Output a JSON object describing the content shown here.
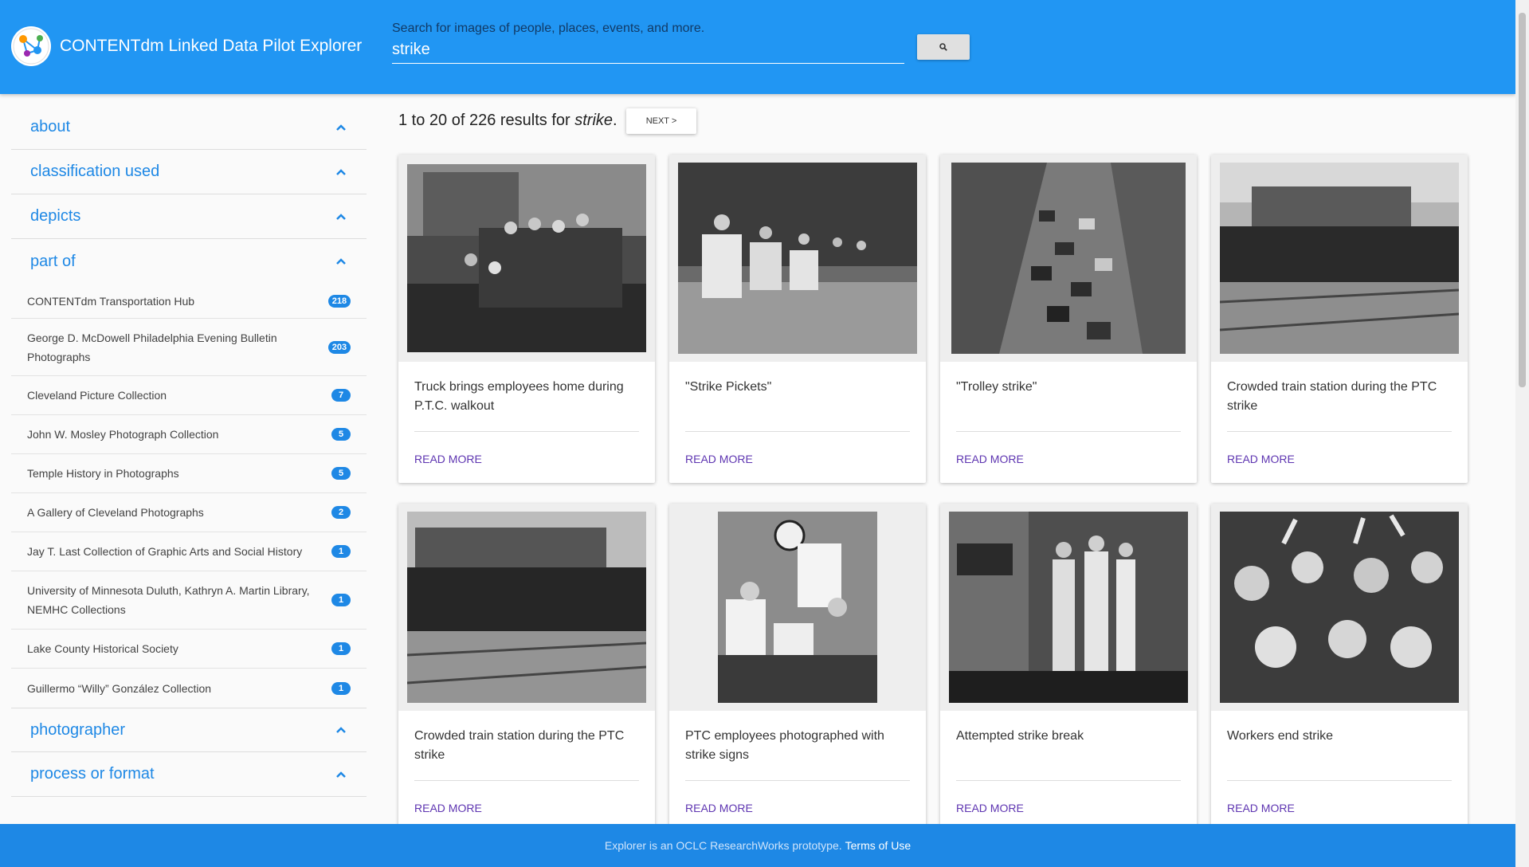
{
  "header": {
    "app_title": "CONTENTdm Linked Data Pilot Explorer",
    "search_hint": "Search for images of people, places, events, and more.",
    "search_value": "strike",
    "search_icon": "search-icon"
  },
  "sidebar": {
    "facets": [
      {
        "label": "about",
        "expanded": false
      },
      {
        "label": "classification used",
        "expanded": false
      },
      {
        "label": "depicts",
        "expanded": false
      },
      {
        "label": "part of",
        "expanded": true
      },
      {
        "label": "photographer",
        "expanded": false
      },
      {
        "label": "process or format",
        "expanded": false
      }
    ],
    "part_of_items": [
      {
        "label": "CONTENTdm Transportation Hub",
        "count": "218"
      },
      {
        "label": "George D. McDowell Philadelphia Evening Bulletin Photographs",
        "count": "203"
      },
      {
        "label": "Cleveland Picture Collection",
        "count": "7"
      },
      {
        "label": "John W. Mosley Photograph Collection",
        "count": "5"
      },
      {
        "label": "Temple History in Photographs",
        "count": "5"
      },
      {
        "label": "A Gallery of Cleveland Photographs",
        "count": "2"
      },
      {
        "label": "Jay T. Last Collection of Graphic Arts and Social History",
        "count": "1"
      },
      {
        "label": "University of Minnesota Duluth, Kathryn A. Martin Library, NEMHC Collections",
        "count": "1"
      },
      {
        "label": "Lake County Historical Society",
        "count": "1"
      },
      {
        "label": "Guillermo “Willy” González Collection",
        "count": "1"
      }
    ]
  },
  "results": {
    "summary_prefix": "1 to 20 of 226 results for",
    "query": "strike",
    "summary_suffix": ".",
    "next_label": "NEXT >"
  },
  "cards": [
    {
      "title": "Truck brings employees home during P.T.C. walkout",
      "link": "READ MORE"
    },
    {
      "title": "\"Strike Pickets\"",
      "link": "READ MORE"
    },
    {
      "title": "\"Trolley strike\"",
      "link": "READ MORE"
    },
    {
      "title": "Crowded train station during the PTC strike",
      "link": "READ MORE"
    },
    {
      "title": "Crowded train station during the PTC strike",
      "link": "READ MORE"
    },
    {
      "title": "PTC employees photographed with strike signs",
      "link": "READ MORE"
    },
    {
      "title": "Attempted strike break",
      "link": "READ MORE"
    },
    {
      "title": "Workers end strike",
      "link": "READ MORE"
    }
  ],
  "footer": {
    "text": "Explorer is an OCLC ResearchWorks prototype.",
    "link": "Terms of Use"
  },
  "colors": {
    "header_bg": "#2196f3",
    "accent": "#1e88e5",
    "link": "#5e35b1"
  }
}
